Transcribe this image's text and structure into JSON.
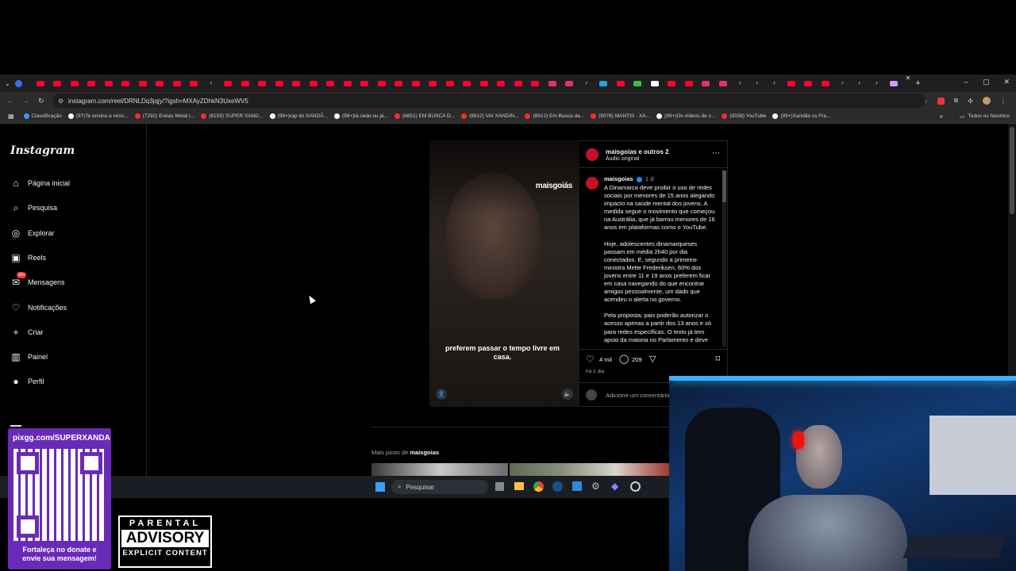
{
  "browser": {
    "tab_favicons": [
      "yt",
      "yt",
      "yt",
      "yt",
      "yt",
      "yt",
      "yt",
      "yt",
      "yt",
      "yt",
      "tk",
      "yt",
      "yt",
      "yt",
      "yt",
      "yt",
      "yt",
      "yt",
      "yt",
      "yt",
      "yt",
      "yt",
      "yt",
      "yt",
      "yt",
      "yt",
      "yt",
      "yt",
      "yt",
      "yt",
      "ig",
      "ig",
      "tk",
      "tg",
      "yt",
      "gn",
      "ch",
      "yt",
      "yt",
      "ig",
      "ig",
      "tk",
      "tk",
      "tk",
      "yt",
      "yt",
      "yt",
      "tk",
      "tk",
      "tk",
      "ms"
    ],
    "url": "instagram.com/reel/DRNLDq3jqjy/?igsh=MXAyZDhkN3UxeWV5",
    "bookmarks": [
      {
        "label": "Classificação",
        "color": "#4a8cff"
      },
      {
        "label": "(97)Te ensino a venc...",
        "color": "#ffffff"
      },
      {
        "label": "(7292) Enéas Metal |...",
        "color": "#ff2b2b"
      },
      {
        "label": "(8159) SUPER XAND...",
        "color": "#ff2b2b"
      },
      {
        "label": "(99+)rap do XANDÃ...",
        "color": "#ffffff"
      },
      {
        "label": "(99+)tá cedo ou já...",
        "color": "#ffffff"
      },
      {
        "label": "(8851) EM BUSCA D...",
        "color": "#ff2b2b"
      },
      {
        "label": "(8912) VAI XANDIN...",
        "color": "#ff2b2b"
      },
      {
        "label": "(8912) Em Busca da...",
        "color": "#ff2b2b"
      },
      {
        "label": "(9078) MANTIS - XA...",
        "color": "#ff2b2b"
      },
      {
        "label": "(99+)Os vídeos de c...",
        "color": "#ffffff"
      },
      {
        "label": "(9338) YouTube",
        "color": "#ff2b2b"
      },
      {
        "label": "(99+)Xandão vs Fra...",
        "color": "#ffffff"
      }
    ],
    "all_bookmarks": "Todos os favoritos"
  },
  "sidebar": {
    "logo": "Instagram",
    "items": [
      {
        "label": "Página inicial",
        "icon": "home-icon",
        "glyph": "⌂"
      },
      {
        "label": "Pesquisa",
        "icon": "search-icon",
        "glyph": "⌕"
      },
      {
        "label": "Explorar",
        "icon": "compass-icon",
        "glyph": "◎"
      },
      {
        "label": "Reels",
        "icon": "reels-icon",
        "glyph": "▣"
      },
      {
        "label": "Mensagens",
        "icon": "messenger-icon",
        "glyph": "✉"
      },
      {
        "label": "Notificações",
        "icon": "heart-icon",
        "glyph": "♡"
      },
      {
        "label": "Criar",
        "icon": "plus-icon",
        "glyph": "+"
      },
      {
        "label": "Painel",
        "icon": "chart-icon",
        "glyph": "▥"
      },
      {
        "label": "Perfil",
        "icon": "avatar-icon",
        "glyph": "●"
      }
    ],
    "messages_badge": "99+"
  },
  "reel": {
    "watermark": "maisgoiás",
    "caption": "preferem passar o tempo livre em casa."
  },
  "post": {
    "header_user": "maisgoias e outros 2",
    "header_audio": "Áudio original",
    "author": "maisgoias",
    "time": "1 d",
    "paragraph1": "A Dinamarca deve proibir o uso de redes sociais por menores de 15 anos alegando impacto na saúde mental dos jovens. A medida segue o movimento que começou na Austrália, que já barrou menores de 16 anos em plataformas como o YouTube.",
    "paragraph2": "Hoje, adolescentes dinamarqueses passam em média 2h40 por dia conectados. E, segundo a primeira-ministra Mette Frederiksen, 60% dos jovens entre 11 e 19 anos preferem ficar em casa navegando do que encontrar amigos pessoalmente, um dado que acendeu o alerta no governo.",
    "paragraph3": "Pela proposta, pais poderão autorizar o acesso apenas a partir dos 13 anos e só para redes específicas. O texto já tem apoio da maioria no Parlamento e deve",
    "likes": "4 mil",
    "comments": "209",
    "posted": "há 1 dia",
    "comment_placeholder": "Adicione um comentário..."
  },
  "more_posts": {
    "prefix": "Mais posts de",
    "user": "maisgoias"
  },
  "taskbar": {
    "search_placeholder": "Pesquisar"
  },
  "overlay": {
    "qr_url": "pixgg.com/SUPERXANDA",
    "qr_message": "Fortaleça no donate e envie sua mensagem!",
    "advisory_top": "PARENTAL",
    "advisory_mid": "ADVISORY",
    "advisory_bottom": "EXPLICIT CONTENT"
  },
  "colors": {
    "yt": "#ff0033",
    "ig": "#e1306c",
    "tk": "#ffffff",
    "badge": "#ff3040",
    "accent": "#0095f6"
  }
}
